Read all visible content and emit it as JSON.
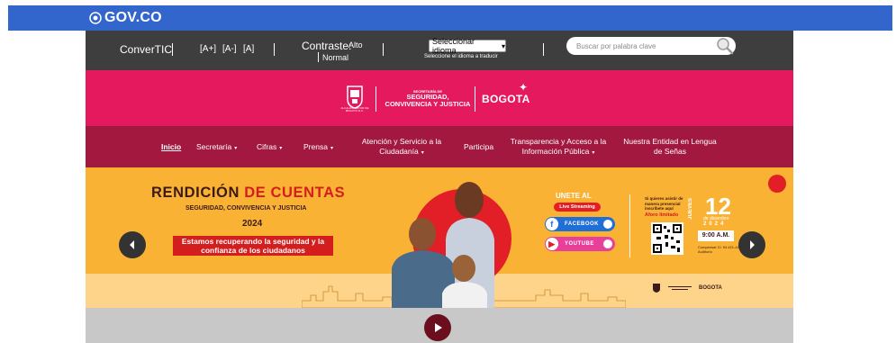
{
  "gov": {
    "brand": "GOV.CO"
  },
  "access": {
    "convertic": "ConverTIC",
    "font_increase": "[A+]",
    "font_decrease": "[A-]",
    "font_reset": "[A]",
    "contrast_label": "Contraste:",
    "contrast_high": "Alto",
    "contrast_normal": "Normal",
    "language_select": "Seleccionar idioma",
    "language_hint": "Seleccione el idioma a traducir",
    "search_placeholder": "Buscar por palabra clave"
  },
  "header": {
    "escudo_caption": "ALCALDÍA MAYOR DE BOGOTÁ D.C.",
    "secretaria_small": "SECRETARÍA DE",
    "secretaria_name": "SEGURIDAD, CONVIVENCIA Y JUSTICIA",
    "city": "BOGOTA"
  },
  "nav": {
    "items": [
      {
        "label": "Inicio"
      },
      {
        "label": "Secretaría"
      },
      {
        "label": "Cifras"
      },
      {
        "label": "Prensa"
      },
      {
        "label": "Atención y Servicio a la Ciudadanía"
      },
      {
        "label": "Participa"
      },
      {
        "label": "Transparencia y Acceso a la Información Pública"
      },
      {
        "label": "Nuestra Entidad en Lengua de Señas"
      }
    ]
  },
  "banner": {
    "title_part1": "RENDICIÓN",
    "title_part2": "DE CUENTAS",
    "subtitle": "SEGURIDAD, CONVIVENCIA Y JUSTICIA",
    "year": "2024",
    "slogan": "Estamos recuperando la seguridad y la confianza de los ciudadanos",
    "join": "UNETE AL",
    "live": "Live Streaming",
    "facebook": "FACEBOOK",
    "youtube": "YOUTUBE",
    "info": "Si quieres asistir de manera presencial inscríbete aquí",
    "aforo": "Aforo limitado",
    "weekday": "JUEVES",
    "day": "12",
    "month": "de diciembre",
    "event_year": "2024",
    "time": "9:00 A.M.",
    "venue": "Compensar Cl. 94 #21-42 Auditorio"
  },
  "colors": {
    "gov_blue": "#3366cc",
    "access_gray": "#3e3e3e",
    "header_pink": "#e5195e",
    "nav_wine": "#a3183e",
    "banner_orange": "#f9b233"
  }
}
